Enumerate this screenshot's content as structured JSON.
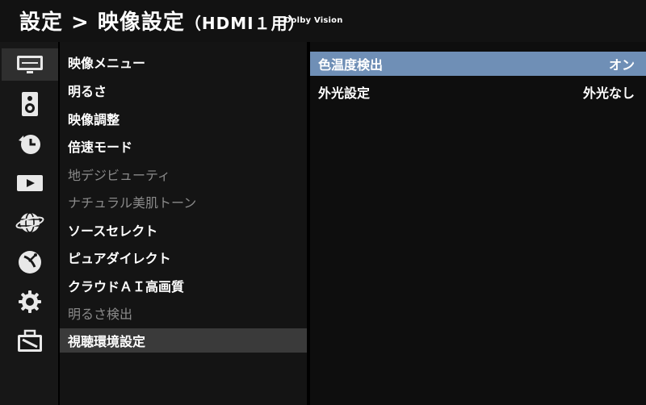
{
  "header": {
    "title": "設定 > 映像設定",
    "subtitle": "（HDMI１用）",
    "badge": "Dolby Vision"
  },
  "sidebar": {
    "icons": [
      {
        "name": "picture-icon",
        "selected": true
      },
      {
        "name": "speaker-icon",
        "selected": false
      },
      {
        "name": "timer-icon",
        "selected": false
      },
      {
        "name": "video-play-icon",
        "selected": false
      },
      {
        "name": "network-globe-icon",
        "selected": false
      },
      {
        "name": "satellite-dish-icon",
        "selected": false
      },
      {
        "name": "gear-icon",
        "selected": false
      },
      {
        "name": "toolbox-icon",
        "selected": false
      }
    ]
  },
  "menu": {
    "items": [
      {
        "label": "映像メニュー",
        "enabled": true,
        "selected": false
      },
      {
        "label": "明るさ",
        "enabled": true,
        "selected": false
      },
      {
        "label": "映像調整",
        "enabled": true,
        "selected": false
      },
      {
        "label": "倍速モード",
        "enabled": true,
        "selected": false
      },
      {
        "label": "地デジビューティ",
        "enabled": false,
        "selected": false
      },
      {
        "label": "ナチュラル美肌トーン",
        "enabled": false,
        "selected": false
      },
      {
        "label": "ソースセレクト",
        "enabled": true,
        "selected": false
      },
      {
        "label": "ピュアダイレクト",
        "enabled": true,
        "selected": false
      },
      {
        "label": "クラウドＡＩ高画質",
        "enabled": true,
        "selected": false
      },
      {
        "label": "明るさ検出",
        "enabled": false,
        "selected": false
      },
      {
        "label": "視聴環境設定",
        "enabled": true,
        "selected": true
      }
    ]
  },
  "detail": {
    "rows": [
      {
        "label": "色温度検出",
        "value": "オン",
        "selected": true
      },
      {
        "label": "外光設定",
        "value": "外光なし",
        "selected": false
      }
    ]
  },
  "colors": {
    "highlight_blue": "#6f8fb6",
    "menu_selected": "#3a3a3a",
    "disabled_text": "#8a8a8a"
  }
}
